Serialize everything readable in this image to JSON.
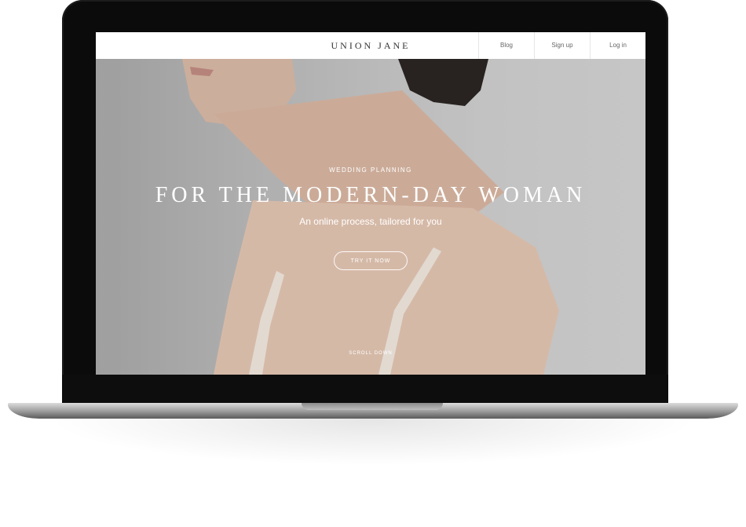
{
  "site": {
    "brand": "UNION JANE",
    "nav": [
      "Blog",
      "Sign up",
      "Log in"
    ]
  },
  "hero": {
    "eyebrow": "WEDDING PLANNING",
    "headline": "FOR THE MODERN-DAY WOMAN",
    "subhead": "An online process, tailored for you",
    "cta": "TRY IT NOW",
    "scroll": "SCROLL DOWN"
  },
  "device": {
    "type": "laptop",
    "bezel_color": "#0b0b0b",
    "body_color": "#b5b5b5"
  }
}
